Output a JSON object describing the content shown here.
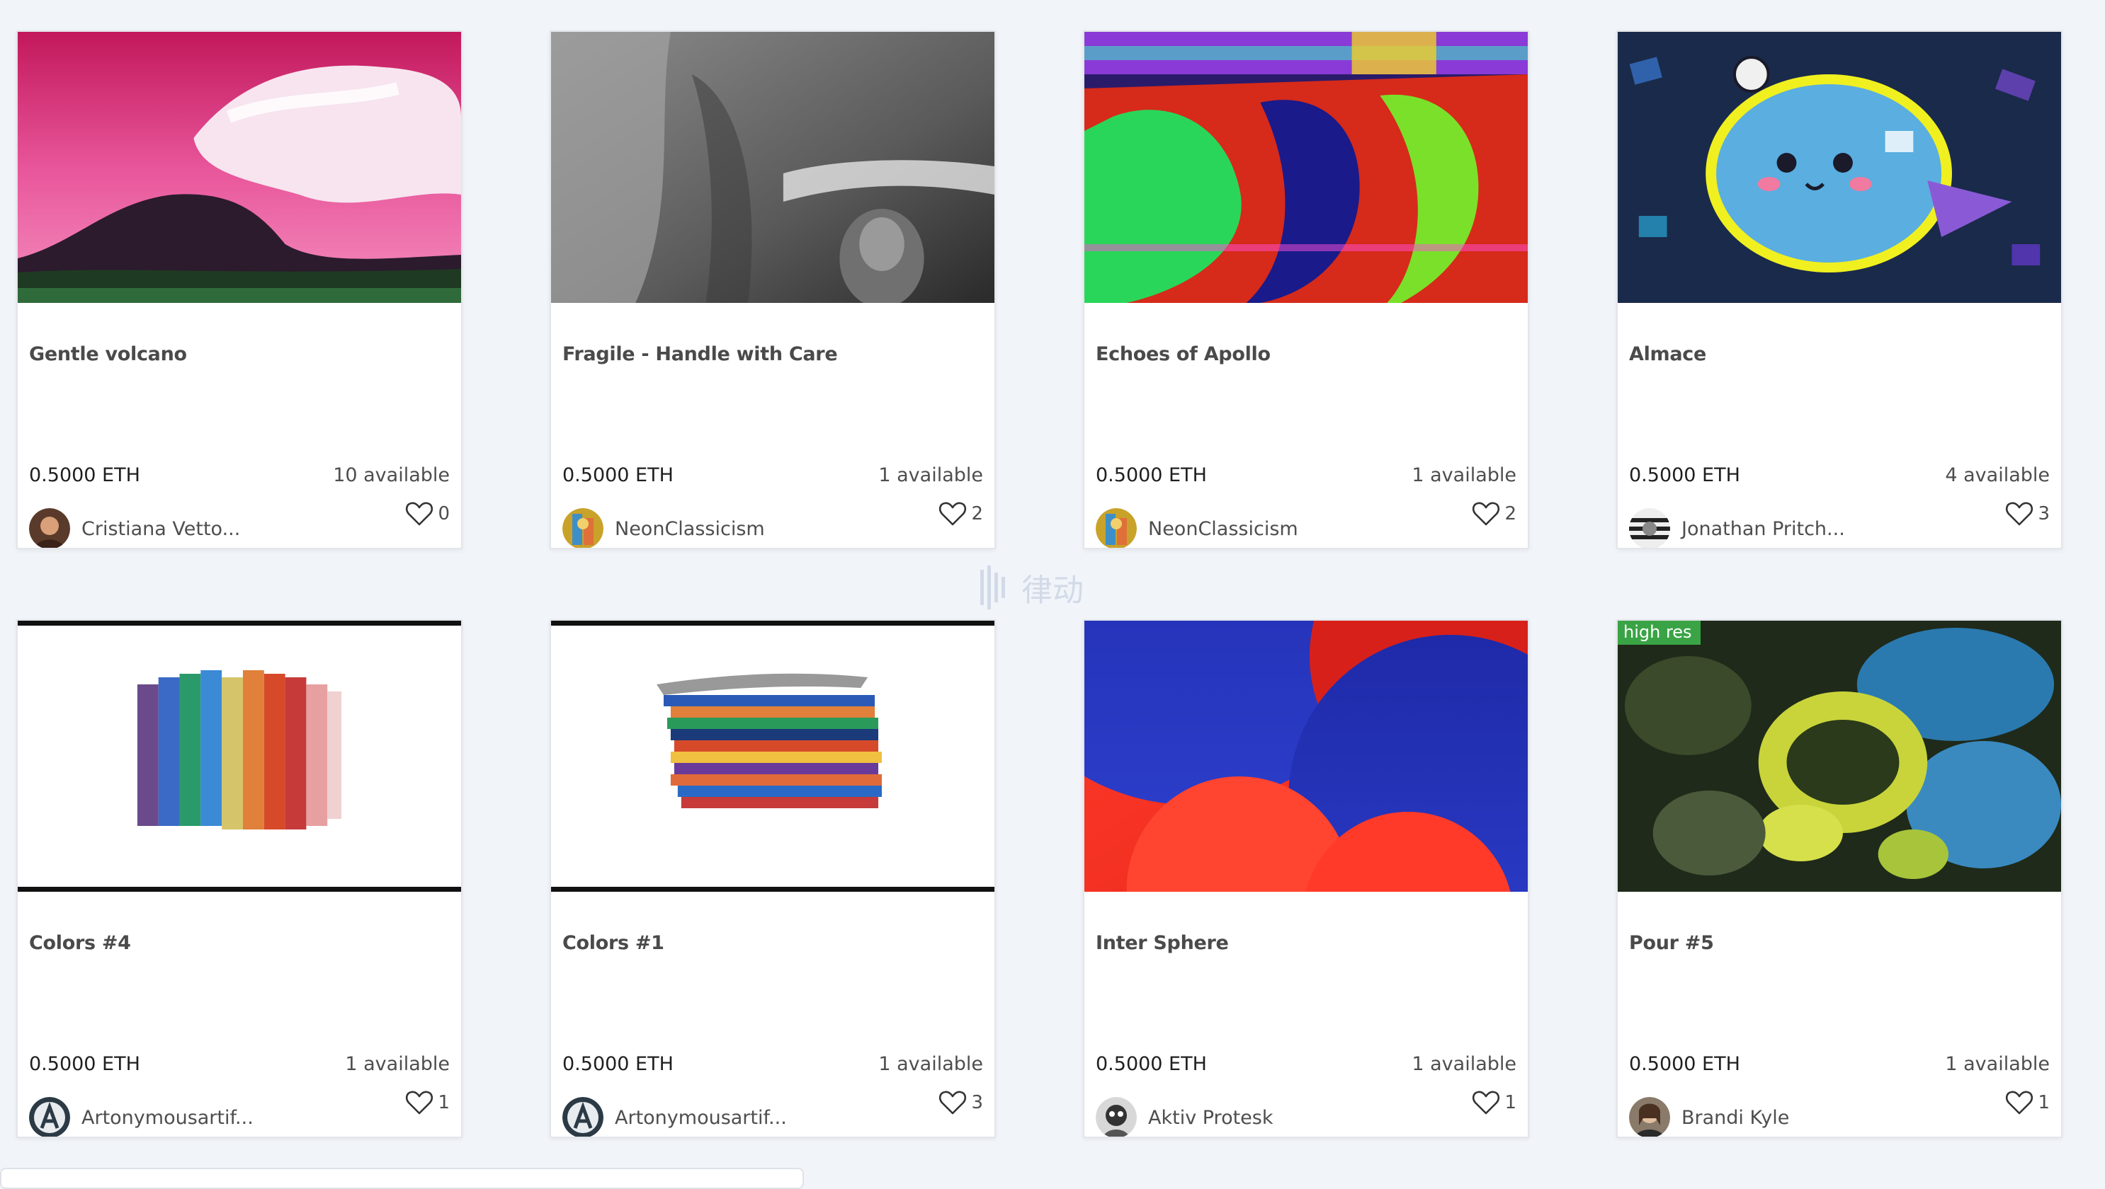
{
  "cards": [
    {
      "title": "Gentle volcano",
      "price": "0.5000 ETH",
      "available": "10 available",
      "creator": "Cristiana Vetto...",
      "likes": "0"
    },
    {
      "title": "Fragile - Handle with Care",
      "price": "0.5000 ETH",
      "available": "1 available",
      "creator": "NeonClassicism",
      "likes": "2"
    },
    {
      "title": "Echoes of Apollo",
      "price": "0.5000 ETH",
      "available": "1 available",
      "creator": "NeonClassicism",
      "likes": "2"
    },
    {
      "title": "Almace",
      "price": "0.5000 ETH",
      "available": "4 available",
      "creator": "Jonathan Pritch...",
      "likes": "3"
    },
    {
      "title": "Colors #4",
      "price": "0.5000 ETH",
      "available": "1 available",
      "creator": "Artonymousartif...",
      "likes": "1"
    },
    {
      "title": "Colors #1",
      "price": "0.5000 ETH",
      "available": "1 available",
      "creator": "Artonymousartif...",
      "likes": "3"
    },
    {
      "title": "Inter Sphere",
      "price": "0.5000 ETH",
      "available": "1 available",
      "creator": "Aktiv Protesk",
      "likes": "1"
    },
    {
      "title": "Pour #5",
      "price": "0.5000 ETH",
      "available": "1 available",
      "creator": "Brandi Kyle",
      "likes": "1",
      "badge": "high res"
    }
  ],
  "watermark": {
    "text": "律动",
    "icon": "blockbeats-logo-icon"
  },
  "icons": {
    "like": "heart-outline-icon"
  },
  "colors": {
    "badge": "#3aa345",
    "background": "#f1f4f9"
  }
}
